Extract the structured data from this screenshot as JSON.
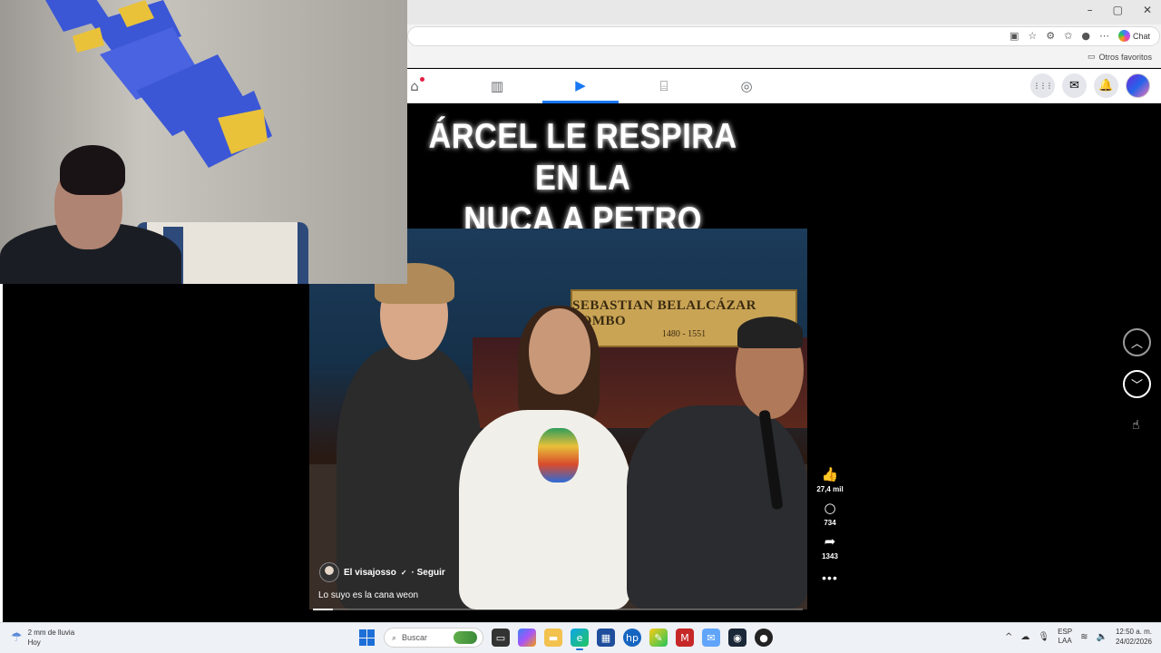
{
  "window": {
    "minimize": "–",
    "maximize": "▢",
    "close": "✕"
  },
  "addressbar": {
    "chat_label": "Chat"
  },
  "favorites": {
    "folder_label": "Otros favoritos"
  },
  "fb_nav": {
    "tabs": [
      {
        "icon": "home-icon",
        "glyph": "⌂"
      },
      {
        "icon": "dashboard-icon",
        "glyph": "▥"
      },
      {
        "icon": "video-icon",
        "glyph": "▶"
      },
      {
        "icon": "marketplace-icon",
        "glyph": "⌸"
      },
      {
        "icon": "gaming-icon",
        "glyph": "◎"
      }
    ],
    "right": {
      "menu": "⋮⋮⋮",
      "messenger": "✉",
      "notifications": "🔔"
    }
  },
  "reel": {
    "title": "ÁRCEL LE RESPIRA EN LA\nNUCA A PETRO",
    "plaque_name": "SEBASTIAN BELALCÁZAR POMBO",
    "plaque_years": "1480 - 1551",
    "author": "El visajosso",
    "verified": "✓",
    "follow": "· Seguir",
    "caption": "Lo suyo es la cana weon",
    "progress": 0.04,
    "likes": "27,4 mil",
    "comments": "734",
    "shares": "1343",
    "more": "•••",
    "like_glyph": "👍",
    "comment_glyph": "○",
    "share_glyph": "➦"
  },
  "nav_arrows": {
    "up": "︿",
    "down": "﹀"
  },
  "taskbar": {
    "weather_line1": "2 mm de lluvia",
    "weather_line2": "Hoy",
    "search_placeholder": "Buscar",
    "lang_line1": "ESP",
    "lang_line2": "LAA",
    "time": "12:50 a. m.",
    "date": "24/02/2026"
  },
  "colors": {
    "facebook_blue": "#1877f2",
    "taskbar_bg": "#eef1f6"
  }
}
